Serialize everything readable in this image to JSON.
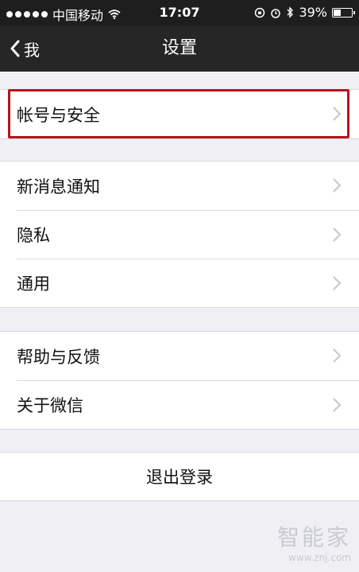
{
  "status_bar": {
    "carrier": "中国移动",
    "time": "17:07",
    "battery": "39%",
    "battery_level": 0.39
  },
  "nav": {
    "back_label": "我",
    "title": "设置"
  },
  "group1": [
    {
      "label": "帐号与安全"
    }
  ],
  "group2": [
    {
      "label": "新消息通知"
    },
    {
      "label": "隐私"
    },
    {
      "label": "通用"
    }
  ],
  "group3": [
    {
      "label": "帮助与反馈"
    },
    {
      "label": "关于微信"
    }
  ],
  "logout_label": "退出登录",
  "watermark": {
    "name": "智能家",
    "url": "www.znj.com"
  }
}
